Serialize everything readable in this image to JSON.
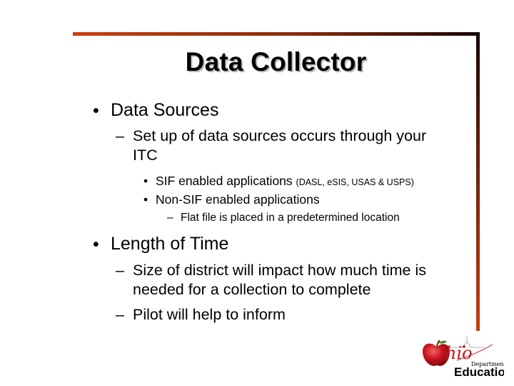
{
  "slide": {
    "title": "Data Collector",
    "bullets": [
      {
        "marker": "•",
        "text": "Data Sources",
        "sub": [
          {
            "marker": "–",
            "lines": [
              "Set up of data sources occurs through your",
              "ITC"
            ]
          }
        ],
        "subsub": [
          {
            "marker": "•",
            "text": "SIF enabled applications",
            "note": "(DASL, eSIS, USAS & USPS)"
          },
          {
            "marker": "•",
            "text": "Non-SIF enabled applications"
          }
        ],
        "subsubsub": [
          {
            "marker": "–",
            "text": "Flat file is placed in a predetermined location"
          }
        ]
      },
      {
        "marker": "•",
        "text": "Length of Time",
        "sub": [
          {
            "marker": "–",
            "lines": [
              "Size of district will impact how much time is",
              "needed for a collection to complete"
            ]
          },
          {
            "marker": "–",
            "lines": [
              "Pilot will help to inform"
            ]
          }
        ]
      }
    ]
  },
  "logo": {
    "script_text": "hio",
    "department": "Department of",
    "name": "Education",
    "icon": "apple-icon",
    "colors": {
      "apple": "#c8121c",
      "script": "#c8121c",
      "text": "#000000"
    }
  },
  "colors": {
    "accent_start": "#c8400e",
    "accent_end": "#1a0402"
  }
}
